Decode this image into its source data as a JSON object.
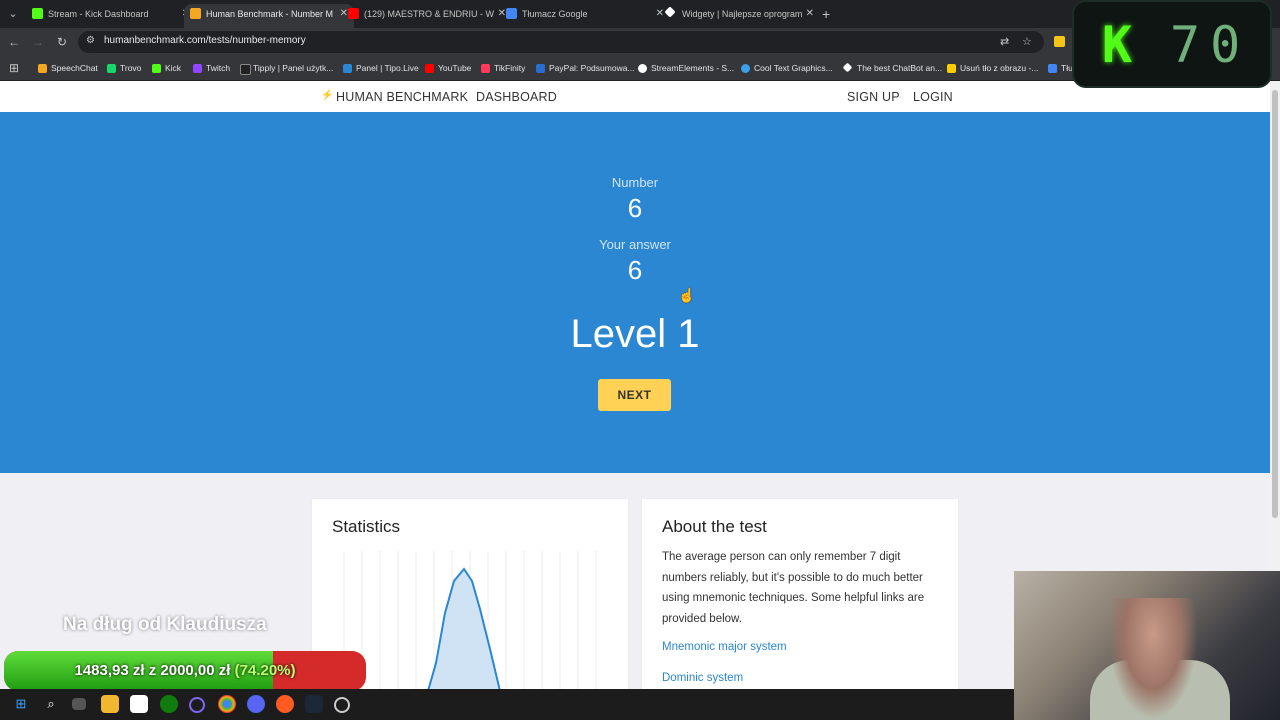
{
  "browser": {
    "tabs": [
      {
        "title": "Stream - Kick Dashboard",
        "color": "#53fc18"
      },
      {
        "title": "Human Benchmark - Number M",
        "color": "#f5a623",
        "active": true
      },
      {
        "title": "(129) MAESTRO & ENDRIU - W",
        "color": "#ff0000"
      },
      {
        "title": "Tłumacz Google",
        "color": "#4285f4"
      },
      {
        "title": "Widgety | Najlepsze oprogram",
        "color": "#ffffff"
      }
    ],
    "url": "humanbenchmark.com/tests/number-memory",
    "bookmarks": [
      {
        "label": "SpeechChat",
        "color": "#f5a623"
      },
      {
        "label": "Trovo",
        "color": "#19d66b"
      },
      {
        "label": "Kick",
        "color": "#53fc18"
      },
      {
        "label": "Twitch",
        "color": "#9146ff"
      },
      {
        "label": "Tipply | Panel użytk...",
        "color": "#222222"
      },
      {
        "label": "Panel | Tipo.Live",
        "color": "#2b87d1"
      },
      {
        "label": "YouTube",
        "color": "#ff0000"
      },
      {
        "label": "TikFinity",
        "color": "#ff3b5c"
      },
      {
        "label": "PayPal: Podsumowa...",
        "color": "#2b6cd1"
      },
      {
        "label": "StreamElements - S...",
        "color": "#ffffff"
      },
      {
        "label": "Cool Text Graphics...",
        "color": "#3aa0e8"
      },
      {
        "label": "The best ChatBot an...",
        "color": "#ffffff"
      },
      {
        "label": "Usuń tło z obrazu -...",
        "color": "#ffcc00"
      },
      {
        "label": "Tłu",
        "color": "#4285f4"
      }
    ]
  },
  "site": {
    "brand": "HUMAN BENCHMARK",
    "dashboard": "DASHBOARD",
    "signup": "SIGN UP",
    "login": "LOGIN"
  },
  "hero": {
    "number_label": "Number",
    "number_value": "6",
    "answer_label": "Your answer",
    "answer_value": "6",
    "level": "Level 1",
    "next": "NEXT"
  },
  "statistics": {
    "title": "Statistics"
  },
  "about": {
    "title": "About the test",
    "text": "The average person can only remember 7 digit numbers reliably, but it's possible to do much better using mnemonic techniques. Some helpful links are provided below.",
    "links": [
      "Mnemonic major system",
      "Dominic system"
    ]
  },
  "overlay": {
    "kick_counter": "70",
    "goal_title": "Na dług od Klaudiusza",
    "goal_amount": "1483,93 zł",
    "goal_sep": "z",
    "goal_target": "2000,00 zł",
    "goal_percent": "(74.20%)",
    "goal_progress": 0.742
  }
}
